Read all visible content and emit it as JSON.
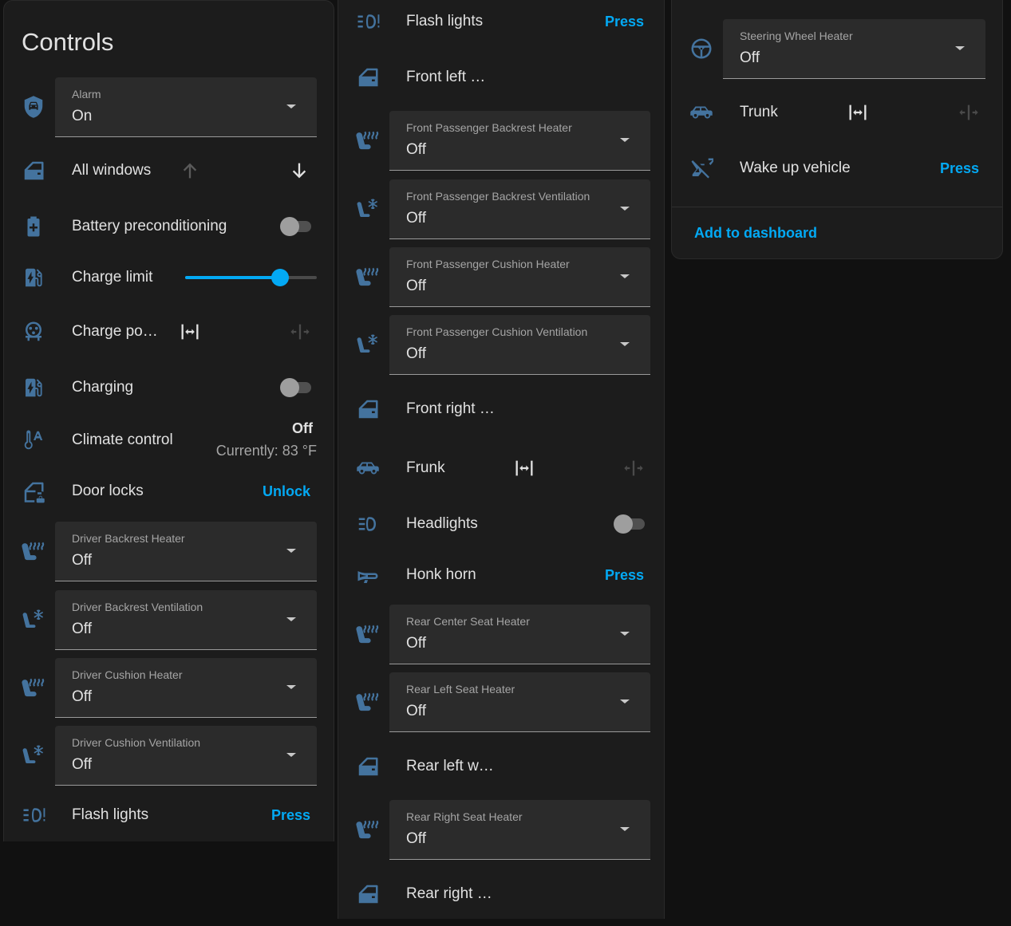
{
  "card": {
    "title": "Controls"
  },
  "col1": {
    "alarm": {
      "label": "Alarm",
      "value": "On"
    },
    "all_windows": {
      "label": "All windows"
    },
    "battery_preconditioning": {
      "label": "Battery preconditioning",
      "on": false
    },
    "charge_limit": {
      "label": "Charge limit",
      "fraction": 0.72
    },
    "charge_port": {
      "label": "Charge po…"
    },
    "charging": {
      "label": "Charging",
      "on": false
    },
    "climate_control": {
      "label": "Climate control",
      "state": "Off",
      "current": "Currently: 83 °F"
    },
    "door_locks": {
      "label": "Door locks",
      "action": "Unlock"
    },
    "driver_backrest_heater": {
      "label": "Driver Backrest Heater",
      "value": "Off"
    },
    "driver_backrest_ventilation": {
      "label": "Driver Backrest Ventilation",
      "value": "Off"
    },
    "driver_cushion_heater": {
      "label": "Driver Cushion Heater",
      "value": "Off"
    },
    "driver_cushion_ventilation": {
      "label": "Driver Cushion Ventilation",
      "value": "Off"
    },
    "flash_lights": {
      "label": "Flash lights",
      "action": "Press"
    }
  },
  "col2": {
    "flash_lights": {
      "label": "Flash lights",
      "action": "Press"
    },
    "front_left": {
      "label": "Front left …"
    },
    "fp_backrest_heater": {
      "label": "Front Passenger Backrest Heater",
      "value": "Off"
    },
    "fp_backrest_ventilation": {
      "label": "Front Passenger Backrest Ventilation",
      "value": "Off"
    },
    "fp_cushion_heater": {
      "label": "Front Passenger Cushion Heater",
      "value": "Off"
    },
    "fp_cushion_ventilation": {
      "label": "Front Passenger Cushion Ventilation",
      "value": "Off"
    },
    "front_right": {
      "label": "Front right …"
    },
    "frunk": {
      "label": "Frunk"
    },
    "headlights": {
      "label": "Headlights",
      "on": false
    },
    "honk_horn": {
      "label": "Honk horn",
      "action": "Press"
    },
    "rear_center_seat_heater": {
      "label": "Rear Center Seat Heater",
      "value": "Off"
    },
    "rear_left_seat_heater": {
      "label": "Rear Left Seat Heater",
      "value": "Off"
    },
    "rear_left_window": {
      "label": "Rear left w…"
    },
    "rear_right_seat_heater": {
      "label": "Rear Right Seat Heater",
      "value": "Off"
    },
    "rear_right": {
      "label": "Rear right …"
    }
  },
  "col3": {
    "steering_wheel_heater": {
      "label": "Steering Wheel Heater",
      "value": "Off"
    },
    "trunk": {
      "label": "Trunk"
    },
    "wake_up": {
      "label": "Wake up vehicle",
      "action": "Press"
    },
    "add_to_dashboard": "Add to dashboard"
  },
  "colors": {
    "icon": "#44739e",
    "accent": "#03a9f4",
    "card": "#1c1c1c",
    "background": "#111111"
  }
}
